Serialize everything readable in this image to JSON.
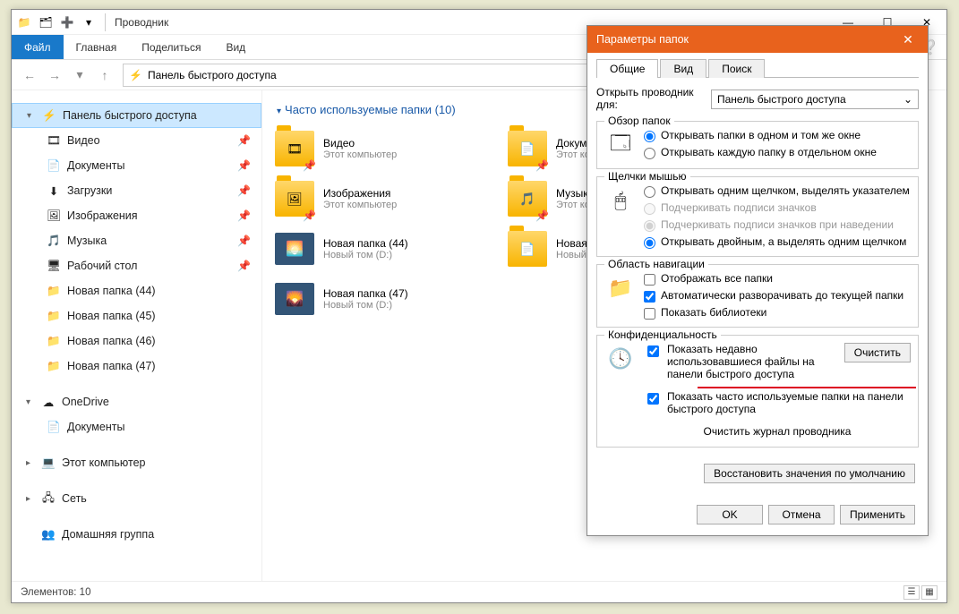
{
  "window": {
    "title": "Проводник",
    "ribbon": {
      "file": "Файл",
      "home": "Главная",
      "share": "Поделиться",
      "view": "Вид"
    },
    "win_controls": {
      "min": "—",
      "max": "☐",
      "close": "✕"
    }
  },
  "address": {
    "crumb": "Панель быстрого доступа"
  },
  "sidebar": {
    "quick_access": "Панель быстрого доступа",
    "items": [
      {
        "label": "Видео"
      },
      {
        "label": "Документы"
      },
      {
        "label": "Загрузки"
      },
      {
        "label": "Изображения"
      },
      {
        "label": "Музыка"
      },
      {
        "label": "Рабочий стол"
      },
      {
        "label": "Новая папка (44)"
      },
      {
        "label": "Новая папка (45)"
      },
      {
        "label": "Новая папка (46)"
      },
      {
        "label": "Новая папка (47)"
      }
    ],
    "onedrive": "OneDrive",
    "onedrive_docs": "Документы",
    "this_pc": "Этот компьютер",
    "network": "Сеть",
    "homegroup": "Домашняя группа"
  },
  "content": {
    "heading": "Часто используемые папки (10)",
    "folders": [
      {
        "name": "Видео",
        "sub": "Этот компьютер"
      },
      {
        "name": "Документы",
        "sub": "Этот компьютер"
      },
      {
        "name": "Изображения",
        "sub": "Этот компьютер"
      },
      {
        "name": "Музыка",
        "sub": "Этот компьютер"
      },
      {
        "name": "Новая папка (44)",
        "sub": "Новый том (D:)"
      },
      {
        "name": "Новая папка",
        "sub": "Новый том (D:)"
      },
      {
        "name": "Новая папка (47)",
        "sub": "Новый том (D:)"
      }
    ]
  },
  "status": {
    "count": "Элементов: 10"
  },
  "dialog": {
    "title": "Параметры папок",
    "tabs": {
      "general": "Общие",
      "view": "Вид",
      "search": "Поиск"
    },
    "open_label": "Открыть проводник для:",
    "open_value": "Панель быстрого доступа",
    "browse": {
      "legend": "Обзор папок",
      "same_window": "Открывать папки в одном и том же окне",
      "new_window": "Открывать каждую папку в отдельном окне"
    },
    "click": {
      "legend": "Щелчки мышью",
      "single": "Открывать одним щелчком, выделять указателем",
      "underline_all": "Подчеркивать подписи значков",
      "underline_hover": "Подчеркивать подписи значков при наведении",
      "double": "Открывать двойным, а выделять одним щелчком"
    },
    "nav": {
      "legend": "Область навигации",
      "show_all": "Отображать все папки",
      "auto_expand": "Автоматически разворачивать до текущей папки",
      "show_lib": "Показать библиотеки"
    },
    "privacy": {
      "legend": "Конфиденциальность",
      "recent_files": "Показать недавно использовавшиеся файлы на панели быстрого доступа",
      "frequent_folders": "Показать часто используемые папки на панели быстрого доступа",
      "clear_btn": "Очистить",
      "clear_history": "Очистить журнал проводника"
    },
    "restore": "Восстановить значения по умолчанию",
    "ok": "OK",
    "cancel": "Отмена",
    "apply": "Применить"
  }
}
